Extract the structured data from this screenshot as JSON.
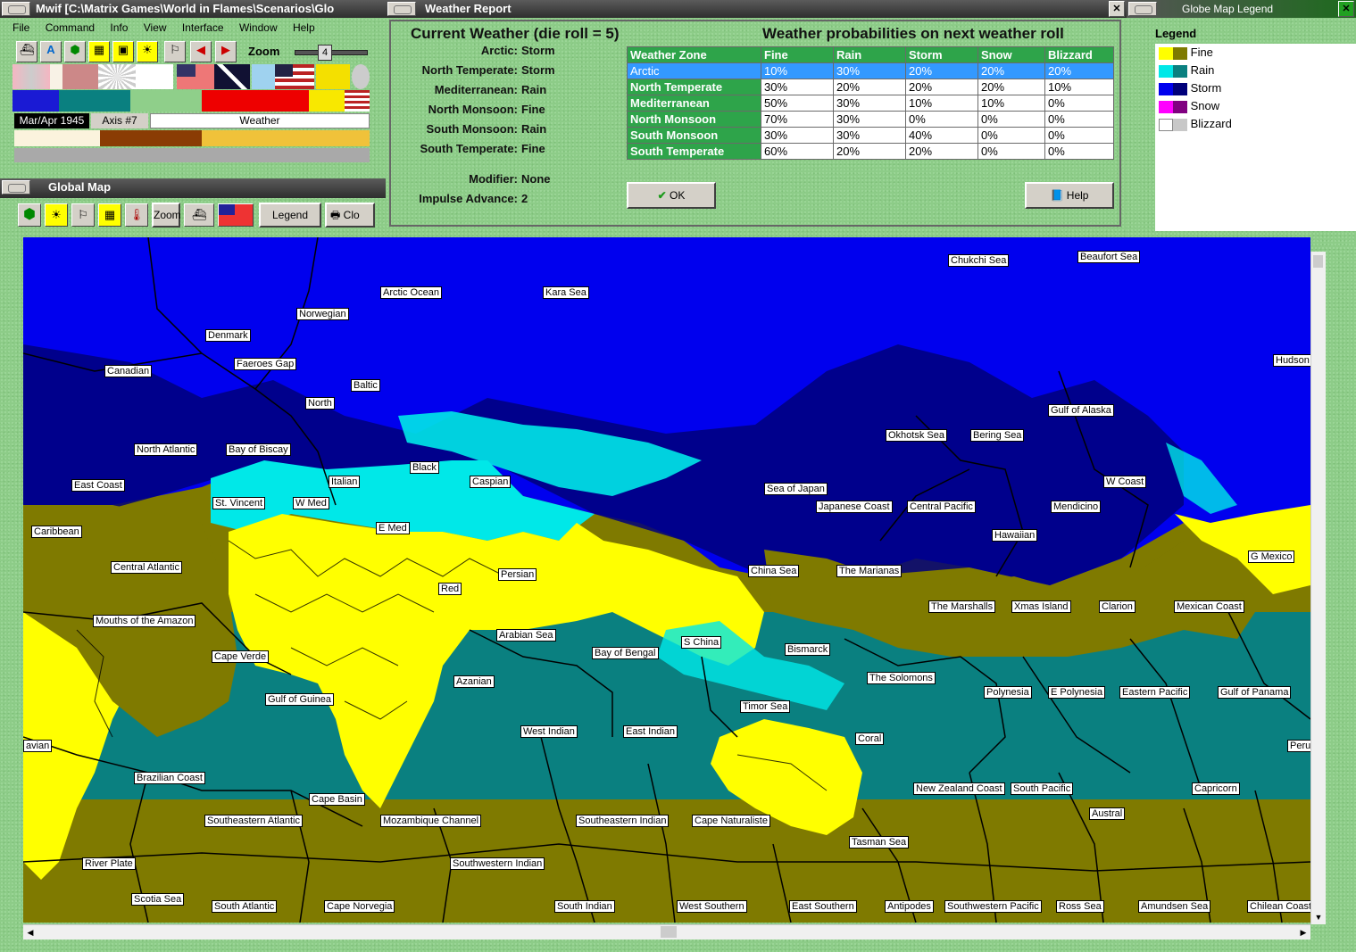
{
  "colors": {
    "fine": "#ffff00",
    "fine_dark": "#7f7a00",
    "rain": "#00e8e8",
    "rain_dark": "#0a8080",
    "storm": "#0000ee",
    "storm_dark": "#00007a",
    "snow": "#ff00ff",
    "snow_dark": "#800080",
    "blizzard": "#ffffff",
    "blizzard_dark": "#c8c8c8",
    "accent_green": "#2ea44a",
    "select_blue": "#3399ff"
  },
  "main_window": {
    "title": "Mwif [C:\\Matrix Games\\World in Flames\\Scenarios\\Glo",
    "menu": [
      "File",
      "Command",
      "Info",
      "View",
      "Interface",
      "Window",
      "Help"
    ],
    "zoom_label": "Zoom",
    "zoom_value": "4",
    "date": "Mar/Apr 1945",
    "axis_label": "Axis #7",
    "phase": "Weather"
  },
  "global_map": {
    "title": "Global Map",
    "zoom_label": "Zoom",
    "legend_label": "Legend",
    "close_label": "Clo"
  },
  "weather_report": {
    "title": "Weather Report",
    "current_heading": "Current Weather (die roll = 5)",
    "current": [
      {
        "zone": "Arctic:",
        "weather": "Storm"
      },
      {
        "zone": "North Temperate:",
        "weather": "Storm"
      },
      {
        "zone": "Mediterranean:",
        "weather": "Rain"
      },
      {
        "zone": "North Monsoon:",
        "weather": "Fine"
      },
      {
        "zone": "South Monsoon:",
        "weather": "Rain"
      },
      {
        "zone": "South Temperate:",
        "weather": "Fine"
      }
    ],
    "modifier_label": "Modifier:",
    "modifier_value": "None",
    "impulse_label": "Impulse Advance:",
    "impulse_value": "2",
    "prob_heading": "Weather probabilities on next weather roll",
    "columns": [
      "Weather Zone",
      "Fine",
      "Rain",
      "Storm",
      "Snow",
      "Blizzard"
    ],
    "rows": [
      [
        "Arctic",
        "10%",
        "30%",
        "20%",
        "20%",
        "20%"
      ],
      [
        "North Temperate",
        "30%",
        "20%",
        "20%",
        "20%",
        "10%"
      ],
      [
        "Mediterranean",
        "50%",
        "30%",
        "10%",
        "10%",
        "0%"
      ],
      [
        "North Monsoon",
        "70%",
        "30%",
        "0%",
        "0%",
        "0%"
      ],
      [
        "South Monsoon",
        "30%",
        "30%",
        "40%",
        "0%",
        "0%"
      ],
      [
        "South Temperate",
        "60%",
        "20%",
        "20%",
        "0%",
        "0%"
      ]
    ],
    "ok_label": "OK",
    "help_label": "Help"
  },
  "legend_window": {
    "title": "Globe Map Legend",
    "heading": "Legend",
    "items": [
      "Fine",
      "Rain",
      "Storm",
      "Snow",
      "Blizzard"
    ]
  },
  "sea_areas": [
    "Chukchi Sea",
    "Beaufort Sea",
    "Arctic Ocean",
    "Kara Sea",
    "Norwegian",
    "Denmark",
    "Canadian",
    "Faeroes Gap",
    "Baltic",
    "Hudson",
    "North",
    "Gulf of Alaska",
    "Okhotsk Sea",
    "Bering Sea",
    "North Atlantic",
    "Bay of Biscay",
    "Black",
    "Caspian",
    "Italian",
    "East Coast",
    "St. Vincent",
    "W Med",
    "Sea of Japan",
    "W Coast",
    "Japanese Coast",
    "Central Pacific",
    "Mendicino",
    "E Med",
    "Caribbean",
    "Hawaiian",
    "G Mexico",
    "Central Atlantic",
    "China Sea",
    "The Marianas",
    "Persian",
    "Red",
    "Mouths of the Amazon",
    "The Marshalls",
    "Xmas Island",
    "Clarion",
    "Mexican Coast",
    "Arabian Sea",
    "S China",
    "Bismarck",
    "Cape Verde",
    "Bay of Bengal",
    "Azanian",
    "The Solomons",
    "Gulf of Guinea",
    "Polynesia",
    "E Polynesia",
    "Eastern Pacific",
    "Gulf of Panama",
    "Timor Sea",
    "West Indian",
    "East Indian",
    "Coral",
    "avian",
    "Peru",
    "Brazilian Coast",
    "New Zealand Coast",
    "South Pacific",
    "Capricorn",
    "Cape Basin",
    "Austral",
    "Southeastern Atlantic",
    "Mozambique Channel",
    "Southeastern Indian",
    "Cape Naturaliste",
    "Tasman Sea",
    "River Plate",
    "Southwestern Indian",
    "Scotia Sea",
    "South Atlantic",
    "Cape Norvegia",
    "South Indian",
    "West Southern",
    "East Southern",
    "Antipodes",
    "Southwestern Pacific",
    "Ross Sea",
    "Amundsen Sea",
    "Chilean Coast"
  ]
}
